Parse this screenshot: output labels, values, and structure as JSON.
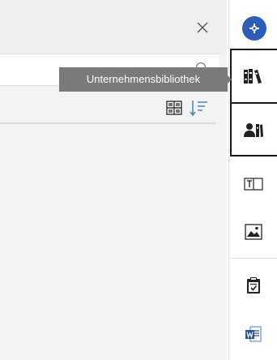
{
  "panel": {
    "close_icon": "close-icon",
    "search": {
      "value": "",
      "placeholder": "",
      "icon": "search-icon"
    },
    "view_toggle_icon": "grid-view-icon",
    "sort_icon": "sort-icon"
  },
  "tooltip": {
    "text": "Unternehmensbibliothek"
  },
  "toolbar": {
    "items": [
      {
        "name": "add",
        "icon": "plus-icon",
        "color": "#2b5db9"
      },
      {
        "name": "company-library",
        "icon": "library-books-icon",
        "highlighted": true
      },
      {
        "name": "personal-library",
        "icon": "user-library-icon",
        "highlighted": true
      },
      {
        "name": "text-box",
        "icon": "text-box-icon"
      },
      {
        "name": "image",
        "icon": "image-icon"
      },
      {
        "name": "clipboard",
        "icon": "clipboard-icon"
      },
      {
        "name": "word-document",
        "icon": "word-document-icon",
        "color": "#2b579a"
      }
    ]
  },
  "colors": {
    "accent": "#2b5db9",
    "tooltip_bg": "#7a7a7a",
    "panel_bg": "#f3f3f3",
    "highlight_border": "#1a1a1a"
  }
}
